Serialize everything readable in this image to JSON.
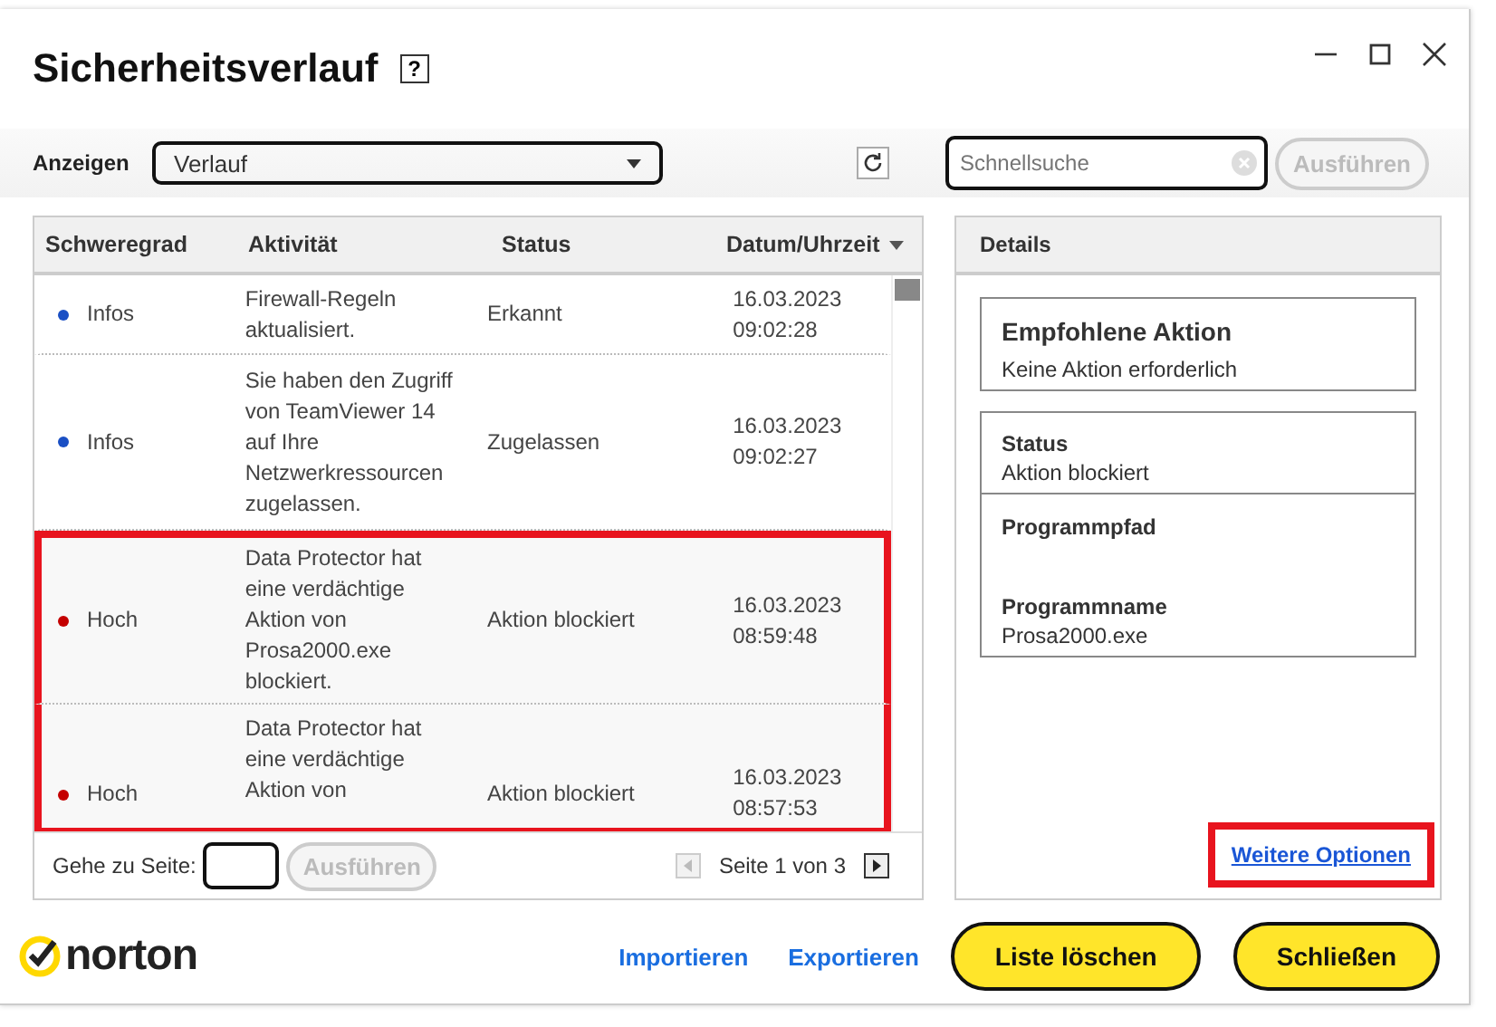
{
  "window": {
    "title": "Sicherheitsverlauf",
    "help_label": "?"
  },
  "toolbar": {
    "show_label": "Anzeigen",
    "view_value": "Verlauf",
    "search": {
      "placeholder": "Schnellsuche"
    },
    "search_button": "Ausführen"
  },
  "table": {
    "columns": [
      "Schweregrad",
      "Aktivität",
      "Status",
      "Datum/Uhrzeit"
    ],
    "rows": [
      {
        "severity": "Infos",
        "color": "#1a4fc4",
        "activity": "Firewall-Regeln aktualisiert.",
        "status": "Erkannt",
        "date": "16.03.2023",
        "time": "09:02:28",
        "highlighted": false
      },
      {
        "severity": "Infos",
        "color": "#1a4fc4",
        "activity": "Sie haben den Zugriff von TeamViewer 14 auf Ihre Netzwerkressourcen zugelassen.",
        "status": "Zugelassen",
        "date": "16.03.2023",
        "time": "09:02:27",
        "highlighted": false
      },
      {
        "severity": "Hoch",
        "color": "#c40000",
        "activity": "Data Protector hat eine verdächtige Aktion von Prosa2000.exe blockiert.",
        "status": "Aktion blockiert",
        "date": "16.03.2023",
        "time": "08:59:48",
        "highlighted": true
      },
      {
        "severity": "Hoch",
        "color": "#c40000",
        "activity": "Data Protector hat eine verdächtige Aktion von",
        "status": "Aktion blockiert",
        "date": "16.03.2023",
        "time": "08:57:53",
        "highlighted": true
      }
    ],
    "goto_label": "Gehe zu Seite:",
    "goto_button": "Ausführen",
    "page_info": "Seite 1 von 3"
  },
  "details": {
    "title": "Details",
    "recommended_heading": "Empfohlene Aktion",
    "recommended_text": "Keine Aktion erforderlich",
    "fields": [
      {
        "label": "Status",
        "value": "Aktion blockiert"
      },
      {
        "label": "Programmpfad"
      },
      {
        "label": "Programmname",
        "value": "Prosa2000.exe"
      }
    ],
    "more_link": "Weitere Optionen",
    "more_highlighted": true
  },
  "footer": {
    "brand": "norton",
    "links": [
      "Importieren",
      "Exportieren"
    ],
    "buttons": [
      "Liste löschen",
      "Schließen"
    ]
  }
}
